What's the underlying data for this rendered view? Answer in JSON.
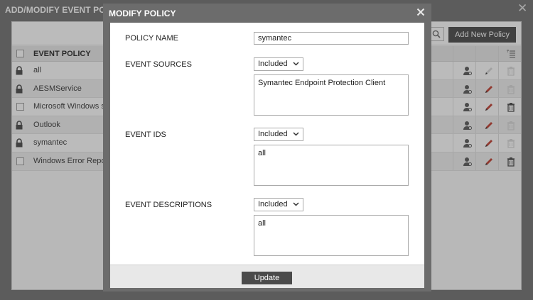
{
  "background": {
    "title": "ADD/MODIFY EVENT POL",
    "add_button": "Add New Policy",
    "column_header": "EVENT POLICY",
    "rows": [
      {
        "name": "all",
        "locked": true,
        "editable": false,
        "deletable": false
      },
      {
        "name": "AESMService",
        "locked": true,
        "editable": true,
        "deletable": false
      },
      {
        "name": "Microsoft Windows s",
        "locked": false,
        "editable": true,
        "deletable": true
      },
      {
        "name": "Outlook",
        "locked": true,
        "editable": true,
        "deletable": false
      },
      {
        "name": "symantec",
        "locked": true,
        "editable": true,
        "deletable": false
      },
      {
        "name": "Windows Error Repor",
        "locked": false,
        "editable": true,
        "deletable": true
      }
    ]
  },
  "modal": {
    "title": "MODIFY POLICY",
    "policy_name_label": "POLICY NAME",
    "policy_name_value": "symantec",
    "event_sources_label": "EVENT SOURCES",
    "event_sources_mode": "Included",
    "event_sources_value": "Symantec Endpoint Protection Client",
    "event_ids_label": "EVENT IDS",
    "event_ids_mode": "Included",
    "event_ids_value": "all",
    "event_descriptions_label": "EVENT DESCRIPTIONS",
    "event_descriptions_mode": "Included",
    "event_descriptions_value": "all",
    "update_button": "Update"
  },
  "colors": {
    "titlebar": "#6c6c6c",
    "button_dark": "#444444",
    "edit_active": "#c0392b",
    "icon_disabled": "#d8d8d8"
  }
}
